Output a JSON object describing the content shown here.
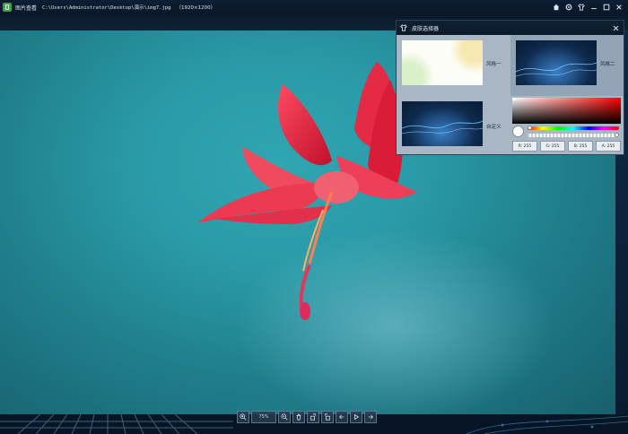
{
  "titlebar": {
    "app_name": "图片查看",
    "file_path": "C:\\Users\\Administrator\\Desktop\\演示\\img7.jpg",
    "dimensions": "（1920×1200）"
  },
  "toolbar": {
    "zoom_label": "75%"
  },
  "skin_panel": {
    "title": "皮肤选择器",
    "themes": [
      {
        "label": "风格一"
      },
      {
        "label": "风格二"
      },
      {
        "label": "自定义"
      }
    ]
  },
  "color_picker": {
    "r_label": "R: 255",
    "g_label": "G: 255",
    "b_label": "B: 255",
    "a_label": "A: 255"
  },
  "colors": {
    "accent": "#3fa14a",
    "petal": "#e83a4c",
    "background_teal": "#2a9aa7"
  }
}
